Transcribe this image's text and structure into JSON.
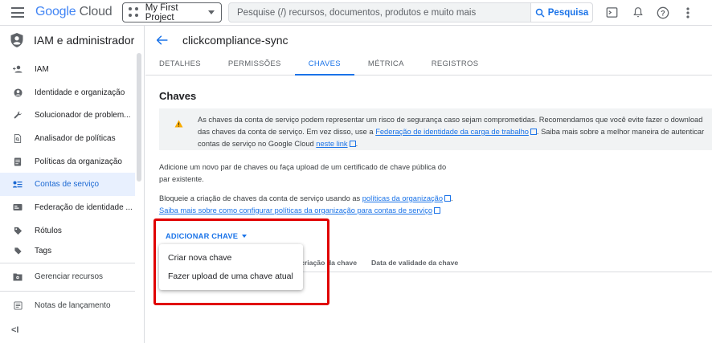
{
  "header": {
    "logo_google": "Google",
    "logo_cloud": "Cloud",
    "project": "My First Project",
    "search_placeholder": "Pesquise (/) recursos, documentos, produtos e muito mais",
    "search_button": "Pesquisa"
  },
  "sidebar": {
    "title": "IAM e administrador",
    "items": [
      {
        "label": "IAM",
        "icon": "person-add-icon"
      },
      {
        "label": "Identidade e organização",
        "icon": "account-circle-icon"
      },
      {
        "label": "Solucionador de problem...",
        "icon": "wrench-icon"
      },
      {
        "label": "Analisador de políticas",
        "icon": "document-search-icon"
      },
      {
        "label": "Políticas da organização",
        "icon": "list-icon"
      },
      {
        "label": "Contas de serviço",
        "icon": "service-account-icon"
      },
      {
        "label": "Federação de identidade ...",
        "icon": "id-card-icon"
      },
      {
        "label": "Rótulos",
        "icon": "label-icon"
      },
      {
        "label": "Tags",
        "icon": "tag-icon"
      }
    ],
    "lower_items": [
      {
        "label": "Gerenciar recursos",
        "icon": "folder-gear-icon"
      },
      {
        "label": "Notas de lançamento",
        "icon": "notes-icon"
      }
    ],
    "collapse_label": "<I"
  },
  "main": {
    "title": "clickcompliance-sync",
    "tabs": [
      "DETALHES",
      "PERMISSÕES",
      "CHAVES",
      "MÉTRICA",
      "REGISTROS"
    ],
    "section_title": "Chaves",
    "warning": {
      "part1": "As chaves da conta de serviço podem representar um risco de segurança caso sejam comprometidas. Recomendamos que você evite fazer o download das chaves da conta de serviço. Em vez disso, use a ",
      "link1": "Federação de identidade da carga de trabalho",
      "part2": ". Saiba mais sobre a melhor maneira de autenticar contas de serviço no Google Cloud ",
      "link2": "neste link",
      "part3": "."
    },
    "para1": "Adicione um novo par de chaves ou faça upload de um certificado de chave pública do par existente.",
    "para2": {
      "part1": "Bloqueie a criação de chaves da conta de serviço usando as ",
      "link1": "políticas da organização",
      "part2": ".",
      "link2": "Saiba mais sobre como configurar políticas da organização para contas de serviço"
    },
    "add_key_button": "ADICIONAR CHAVE",
    "table_columns": [
      "criação da chave",
      "Data de validade da chave"
    ],
    "menu_items": [
      "Criar nova chave",
      "Fazer upload de uma chave atual"
    ]
  },
  "colors": {
    "accent": "#1a73e8",
    "highlight": "#e00000",
    "warning": "#f9ab00"
  }
}
